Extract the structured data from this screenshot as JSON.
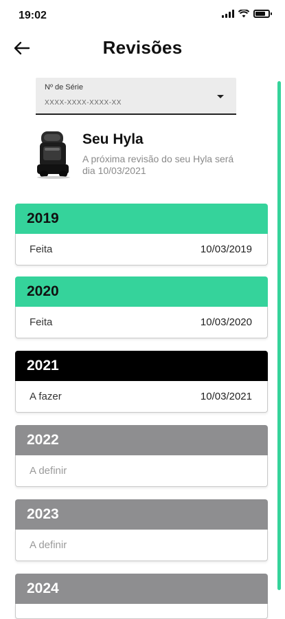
{
  "status_bar": {
    "time": "19:02"
  },
  "header": {
    "title": "Revisões"
  },
  "serial": {
    "label": "Nº de Série",
    "value": "XXXX-XXXX-XXXX-XX"
  },
  "product": {
    "name": "Seu Hyla",
    "description": "A próxima revisão do seu Hyla será dia 10/03/2021"
  },
  "colors": {
    "done": "#35d39b",
    "current": "#000000",
    "future": "#8e8e90"
  },
  "revisions": [
    {
      "year": "2019",
      "status": "Feita",
      "date": "10/03/2019",
      "state": "done"
    },
    {
      "year": "2020",
      "status": "Feita",
      "date": "10/03/2020",
      "state": "done"
    },
    {
      "year": "2021",
      "status": "A fazer",
      "date": "10/03/2021",
      "state": "current"
    },
    {
      "year": "2022",
      "status": "A definir",
      "date": "",
      "state": "future"
    },
    {
      "year": "2023",
      "status": "A definir",
      "date": "",
      "state": "future"
    },
    {
      "year": "2024",
      "status": "",
      "date": "",
      "state": "future"
    }
  ]
}
